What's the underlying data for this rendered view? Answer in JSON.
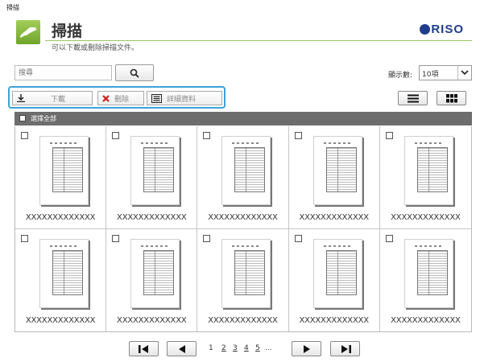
{
  "window_title": "掃描",
  "header": {
    "title": "掃描",
    "subtitle": "可以下載或刪除掃描文件。",
    "brand": "RISO"
  },
  "search": {
    "placeholder": "搜尋"
  },
  "display": {
    "label": "顯示數:",
    "selected": "10項"
  },
  "toolbar": {
    "download_label": "下載",
    "delete_label": "刪除",
    "details_label": "詳細資料"
  },
  "select_all_label": "選擇全部",
  "files": [
    {
      "name": "XXXXXXXXXXXXX"
    },
    {
      "name": "XXXXXXXXXXXXX"
    },
    {
      "name": "XXXXXXXXXXXXX"
    },
    {
      "name": "XXXXXXXXXXXXX"
    },
    {
      "name": "XXXXXXXXXXXXX"
    },
    {
      "name": "XXXXXXXXXXXXX"
    },
    {
      "name": "XXXXXXXXXXXXX"
    },
    {
      "name": "XXXXXXXXXXXXX"
    },
    {
      "name": "XXXXXXXXXXXXX"
    },
    {
      "name": "XXXXXXXXXXXXX"
    }
  ],
  "pagination": {
    "current": "1",
    "pages": [
      "2",
      "3",
      "4",
      "5"
    ],
    "ellipsis": "..."
  },
  "colors": {
    "accent_green": "#7ab638",
    "highlight_blue": "#3ba2d9",
    "brand_blue": "#1f3d8a",
    "delete_red": "#d11a1a"
  }
}
